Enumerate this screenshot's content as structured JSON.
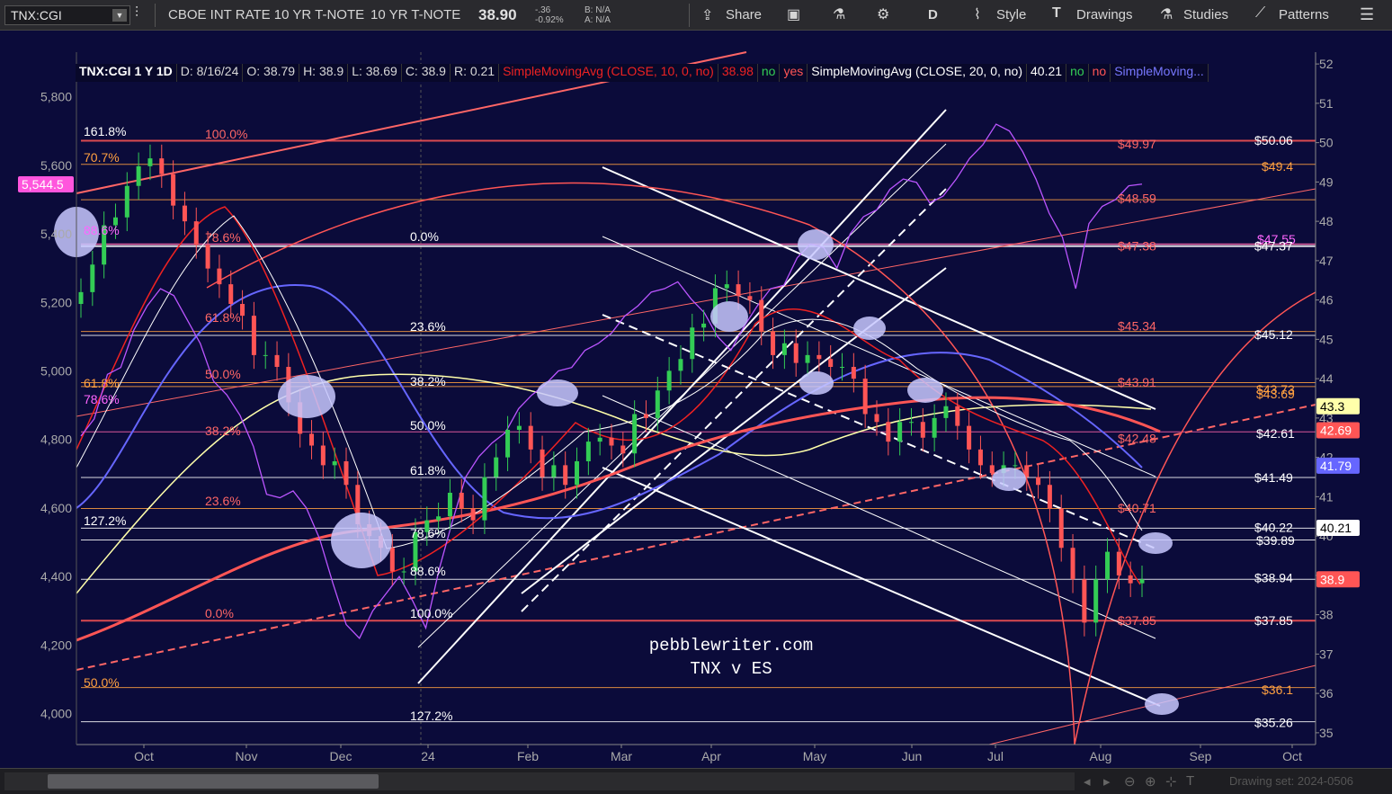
{
  "toolbar": {
    "symbol": "TNX:CGI",
    "description_1": "CBOE INT RATE 10 YR T-NOTE",
    "description_2": "10 YR T-NOTE",
    "last_price": "38.90",
    "change": "-.36",
    "change_pct": "-0.92%",
    "bid": "B: N/A",
    "ask": "A: N/A",
    "share_label": "Share",
    "period_label": "D",
    "style_label": "Style",
    "drawings_label": "Drawings",
    "studies_label": "Studies",
    "patterns_label": "Patterns"
  },
  "info_row": {
    "symbol_period": "TNX:CGI 1 Y 1D",
    "date": "D: 8/16/24",
    "open": "O: 38.79",
    "high": "H: 38.9",
    "low": "L: 38.69",
    "close": "C: 38.9",
    "range": "R: 0.21",
    "sma10_label": "SimpleMovingAvg (CLOSE, 10, 0, no)",
    "sma10_value": "38.98",
    "sma10_flag1": "no",
    "sma10_flag2": "yes",
    "sma20_label": "SimpleMovingAvg (CLOSE, 20, 0, no)",
    "sma20_value": "40.21",
    "sma20_flag1": "no",
    "sma20_flag2": "no",
    "sma_more": "SimpleMoving..."
  },
  "watermark": {
    "line1": "pebblewriter.com",
    "line2": "TNX v ES"
  },
  "bottom_bar": {
    "drawing_set": "Drawing set: 2024-0506"
  },
  "colors": {
    "background": "#0b0b3a",
    "up_candle": "#33cc55",
    "down_candle": "#ff5555",
    "sma10": "#ee2222",
    "sma20": "#ffffff",
    "sma50": "#6666ff",
    "sma100": "#ffffaa",
    "sma200": "#ff5555",
    "es_line": "#bb55ff",
    "fib_orange": "#ffa040",
    "fib_white": "#ffffff",
    "fib_pink": "#ff66aa"
  },
  "chart_data": {
    "type": "candlestick",
    "title": "TNX:CGI 1 Y 1D",
    "x_labels": [
      "Oct",
      "Nov",
      "Dec",
      "24",
      "Feb",
      "Mar",
      "Apr",
      "May",
      "Jun",
      "Jul",
      "Aug",
      "Sep",
      "Oct"
    ],
    "y_right": {
      "ticks": [
        35,
        36,
        37,
        38,
        39,
        40,
        41,
        42,
        43,
        44,
        45,
        46,
        47,
        48,
        49,
        50,
        51,
        52
      ],
      "range": [
        34.7,
        52.3
      ]
    },
    "y_left": {
      "ticks": [
        "4,000",
        "4,200",
        "4,400",
        "4,600",
        "4,800",
        "5,000",
        "5,200",
        "5,400",
        "5,600",
        "5,800"
      ],
      "range": [
        3910,
        5930
      ]
    },
    "right_axis_badges": [
      {
        "label": "43.3",
        "value": 43.3,
        "color": "#ffffaa"
      },
      {
        "label": "42.69",
        "value": 42.69,
        "color": "#ff5555"
      },
      {
        "label": "41.79",
        "value": 41.79,
        "color": "#6666ff"
      },
      {
        "label": "40.21",
        "value": 40.21,
        "color": "#ffffff"
      },
      {
        "label": "38.9",
        "value": 38.9,
        "color": "#ff5555"
      }
    ],
    "left_axis_badge": {
      "label": "5,544.5",
      "value": 5544.5,
      "color": "#ff55dd"
    },
    "tnx_close": [
      46.2,
      46.9,
      47.9,
      48.1,
      48.9,
      49.4,
      49.6,
      49.2,
      48.4,
      48.0,
      47.4,
      46.8,
      46.4,
      45.9,
      45.6,
      44.6,
      44.6,
      44.3,
      43.4,
      42.6,
      42.3,
      41.8,
      41.9,
      41.3,
      40.3,
      40.0,
      39.7,
      39.1,
      39.1,
      40.1,
      40.4,
      40.5,
      41.1,
      40.7,
      40.4,
      41.5,
      42.0,
      42.7,
      42.8,
      42.2,
      41.5,
      41.8,
      41.3,
      41.9,
      42.4,
      42.5,
      42.3,
      42.1,
      43.1,
      43.0,
      43.7,
      44.2,
      44.5,
      45.3,
      45.4,
      46.3,
      46.4,
      46.1,
      46.0,
      45.2,
      44.6,
      44.9,
      44.4,
      44.6,
      44.5,
      44.3,
      44.3,
      44.0,
      43.1,
      42.9,
      42.4,
      42.9,
      42.9,
      42.5,
      43.0,
      43.3,
      42.8,
      42.2,
      41.8,
      41.6,
      41.8,
      41.8,
      41.5,
      41.3,
      40.7,
      39.7,
      38.9,
      37.8,
      38.9,
      39.6,
      39.0,
      38.8,
      38.9
    ],
    "es_close": [
      4810,
      4860,
      4990,
      5010,
      5120,
      5190,
      5240,
      5220,
      5150,
      5080,
      4970,
      4930,
      4870,
      4780,
      4640,
      4630,
      4650,
      4600,
      4510,
      4380,
      4260,
      4220,
      4300,
      4350,
      4400,
      4330,
      4250,
      4420,
      4560,
      4690,
      4750,
      4790,
      4820,
      4890,
      4930,
      4960,
      5000,
      5010,
      5060,
      5080,
      5110,
      5160,
      5190,
      5230,
      5240,
      5260,
      5210,
      5170,
      5100,
      5060,
      5130,
      5190,
      5240,
      5250,
      5330,
      5370,
      5360,
      5300,
      5400,
      5450,
      5470,
      5530,
      5560,
      5550,
      5490,
      5510,
      5560,
      5620,
      5660,
      5720,
      5700,
      5640,
      5560,
      5460,
      5390,
      5240,
      5430,
      5480,
      5500,
      5540,
      5545
    ]
  }
}
